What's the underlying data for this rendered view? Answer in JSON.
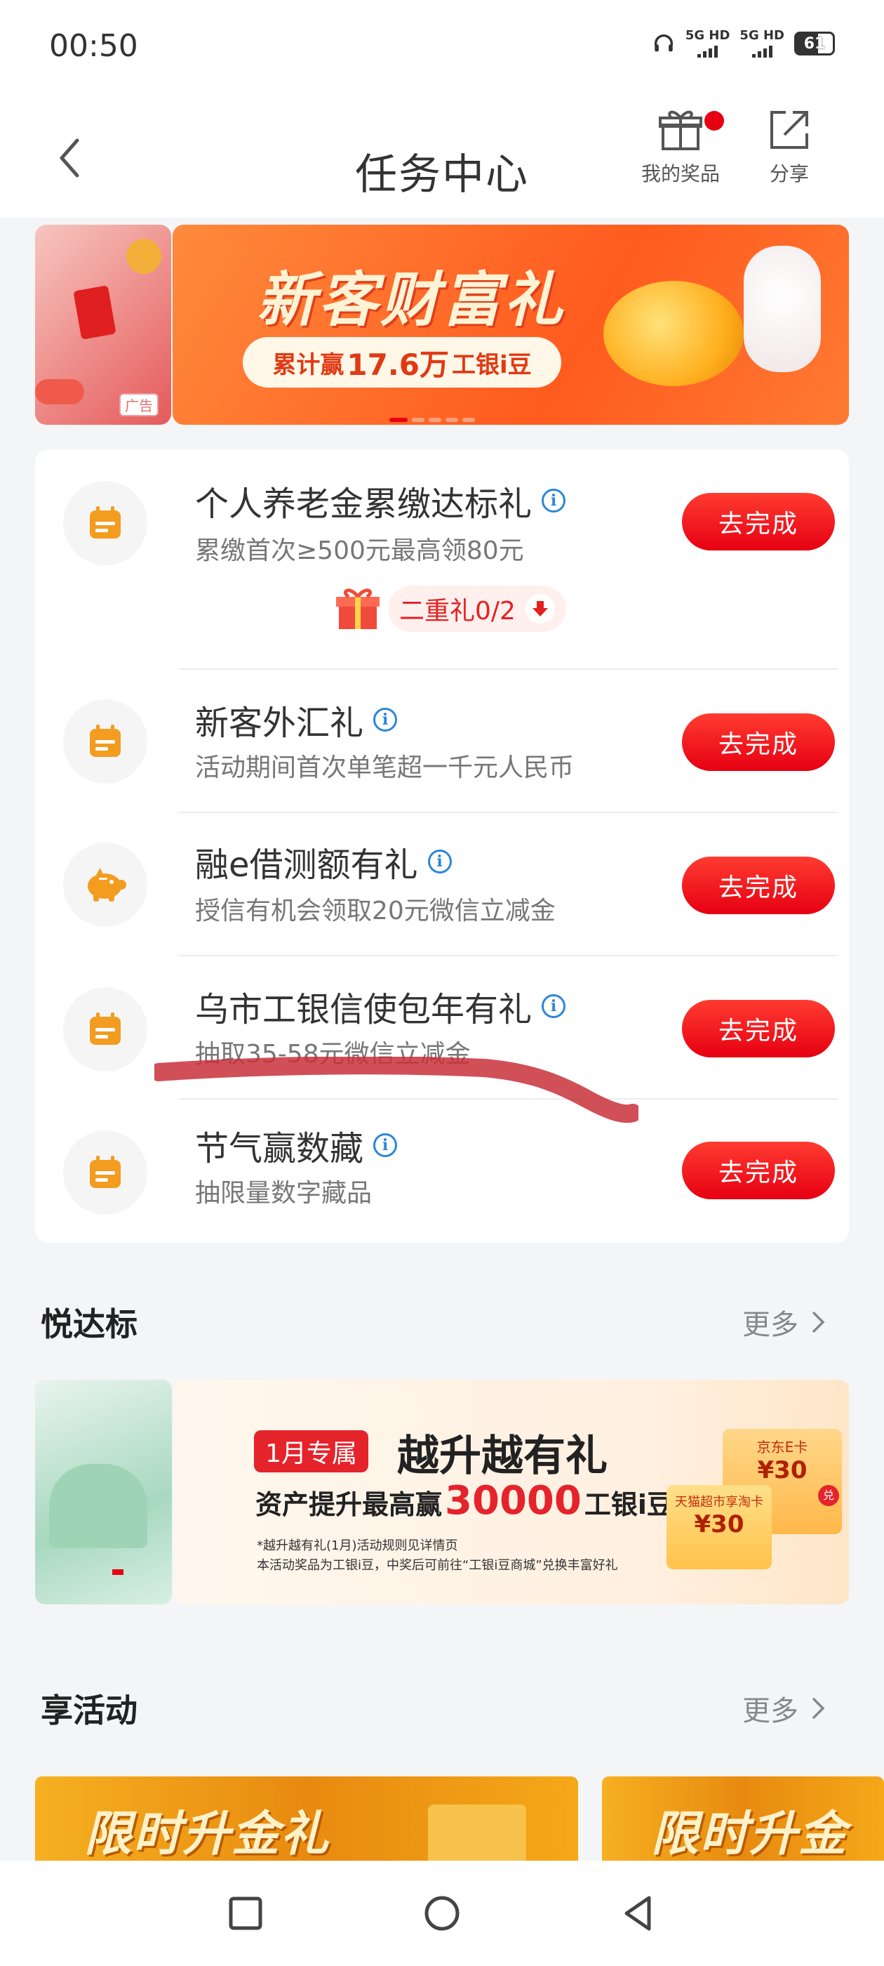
{
  "status_bar": {
    "time": "00:50",
    "sim1": "5G HD",
    "sim2": "5G HD",
    "battery": "61"
  },
  "header": {
    "title": "任务中心",
    "prize_label": "我的奖品",
    "share_label": "分享"
  },
  "top_banner": {
    "title": "新客财富礼",
    "pill_prefix": "累计赢",
    "pill_amount": "17.6万",
    "pill_suffix": "工银i豆",
    "ad_tag": "广告"
  },
  "tasks": [
    {
      "title": "个人养老金累缴达标礼",
      "desc": "累缴首次≥500元最高领80元",
      "button": "去完成",
      "icon": "calendar-icon"
    },
    {
      "title": "新客外汇礼",
      "desc": "活动期间首次单笔超一千元人民币",
      "button": "去完成",
      "icon": "calendar-icon"
    },
    {
      "title": "融e借测额有礼",
      "desc": "授信有机会领取20元微信立减金",
      "button": "去完成",
      "icon": "piggy-bank-icon"
    },
    {
      "title": "乌市工银信使包年有礼",
      "desc": "抽取35-58元微信立减金",
      "button": "去完成",
      "icon": "calendar-icon"
    },
    {
      "title": "节气赢数藏",
      "desc": "抽限量数字藏品",
      "button": "去完成",
      "icon": "calendar-icon"
    }
  ],
  "double_gift": {
    "label": "二重礼0/2"
  },
  "section_yue": {
    "title": "悦达标",
    "more": "更多"
  },
  "yue_banner": {
    "tag": "1月专属",
    "title": "越升越有礼",
    "line_prefix": "资产提升最高赢",
    "line_amount": "30000",
    "line_suffix": "工银i豆",
    "note1": "*越升越有礼(1月)活动规则见详情页",
    "note2": "本活动奖品为工银i豆，中奖后可前往“工银i豆商城”兑换丰富好礼",
    "coupon1_label": "京东E卡",
    "coupon1_value": "¥30",
    "coupon2_label": "天猫超市享淘卡",
    "coupon2_value": "¥30",
    "coupon_badge": "兑"
  },
  "section_xiang": {
    "title": "享活动",
    "more": "更多"
  },
  "activity_banners": [
    {
      "title": "限时升金礼"
    },
    {
      "title": "限时升金礼"
    }
  ],
  "colors": {
    "brand_red": "#e60012",
    "info_blue": "#2c86d8",
    "icon_orange": "#f39c1f"
  }
}
